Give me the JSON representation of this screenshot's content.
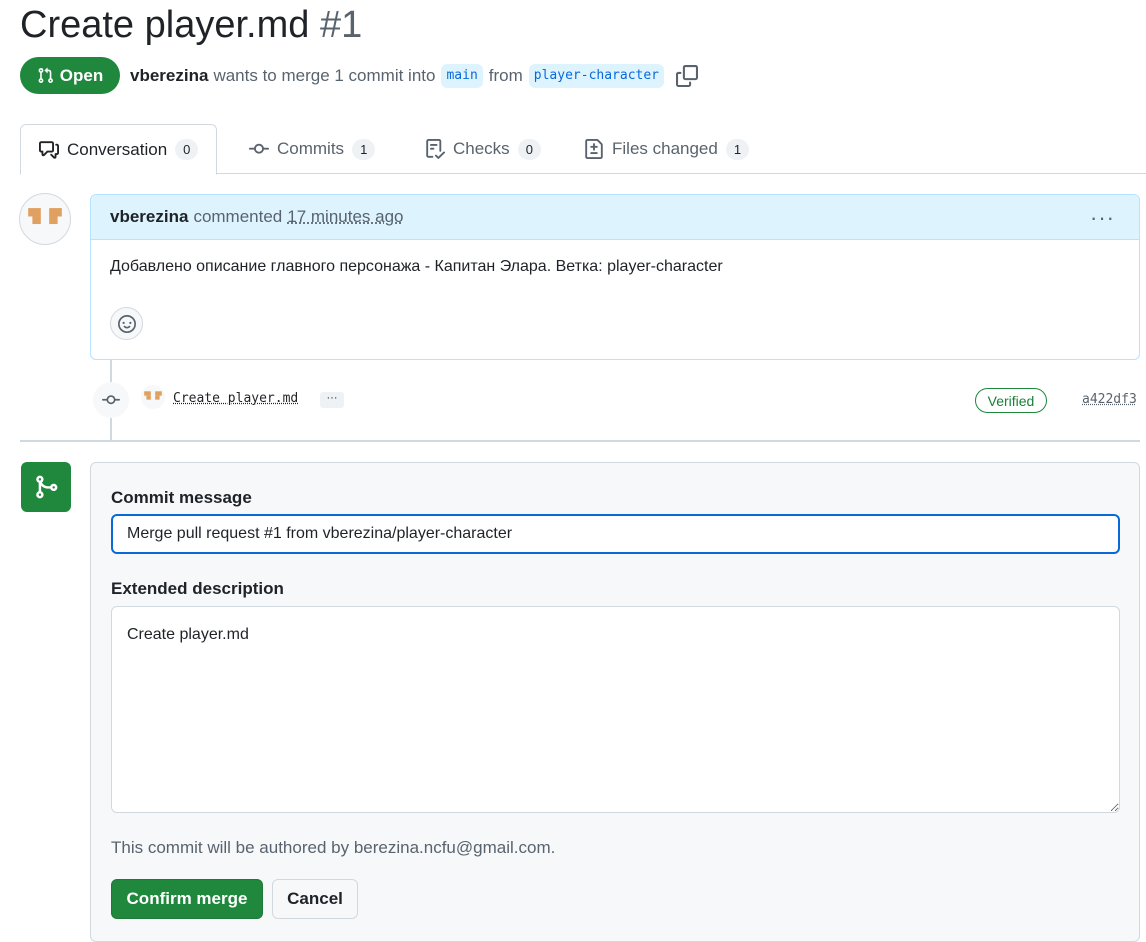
{
  "pr": {
    "title": "Create player.md",
    "number": "#1",
    "state": "Open",
    "author": "vberezina",
    "merge_text": "wants to merge 1 commit into",
    "base_branch": "main",
    "from_text": "from",
    "head_branch": "player-character"
  },
  "tabs": [
    {
      "label": "Conversation",
      "count": "0",
      "icon": "comment-discussion-icon"
    },
    {
      "label": "Commits",
      "count": "1",
      "icon": "git-commit-icon"
    },
    {
      "label": "Checks",
      "count": "0",
      "icon": "checklist-icon"
    },
    {
      "label": "Files changed",
      "count": "1",
      "icon": "file-diff-icon"
    }
  ],
  "comment": {
    "author": "vberezina",
    "action": "commented",
    "time": "17 minutes ago",
    "body": "Добавлено описание главного персонажа - Капитан Элара. Ветка: player-character"
  },
  "commit": {
    "message": "Create player.md",
    "ellipsis": "···",
    "verified": "Verified",
    "sha": "a422df3"
  },
  "merge": {
    "commit_message_label": "Commit message",
    "commit_message_value": "Merge pull request #1 from vberezina/player-character",
    "extended_label": "Extended description",
    "extended_value": "Create player.md",
    "author_note": "This commit will be authored by berezina.ncfu@gmail.com.",
    "confirm_label": "Confirm merge",
    "cancel_label": "Cancel"
  },
  "colors": {
    "accent_green": "#1f883d",
    "accent_blue": "#0969da",
    "header_blue": "#ddf4ff"
  }
}
